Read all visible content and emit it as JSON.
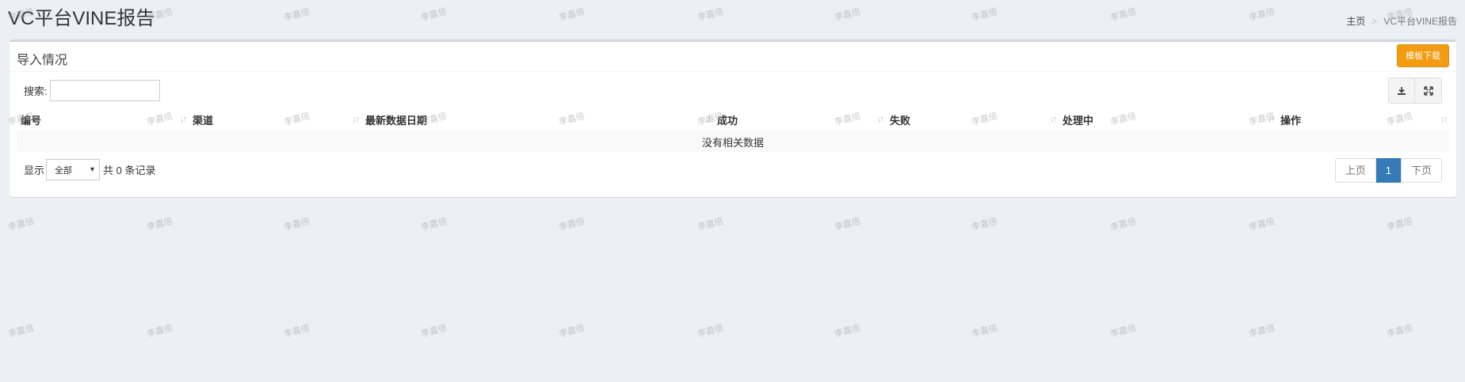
{
  "header": {
    "title": "VC平台VINE报告"
  },
  "breadcrumb": {
    "home": "主页",
    "separator": ">",
    "current": "VC平台VINE报告"
  },
  "panel": {
    "title": "导入情况",
    "template_button": "模板下载"
  },
  "toolbar": {
    "search_label": "搜索:",
    "search_value": "",
    "export_icon": "download-icon",
    "fullscreen_icon": "fullscreen-icon"
  },
  "table": {
    "columns": [
      "编号",
      "渠道",
      "最新数据日期",
      "成功",
      "失败",
      "处理中",
      "操作"
    ],
    "empty_text": "没有相关数据"
  },
  "footer": {
    "show_label": "显示",
    "page_size": "全部",
    "total_label": "共 0 条记录",
    "prev": "上页",
    "current_page": "1",
    "next": "下页"
  },
  "watermark": "李嘉倍",
  "colors": {
    "accent": "#337ab7",
    "warning": "#f39c12",
    "background": "#ecf0f5"
  }
}
